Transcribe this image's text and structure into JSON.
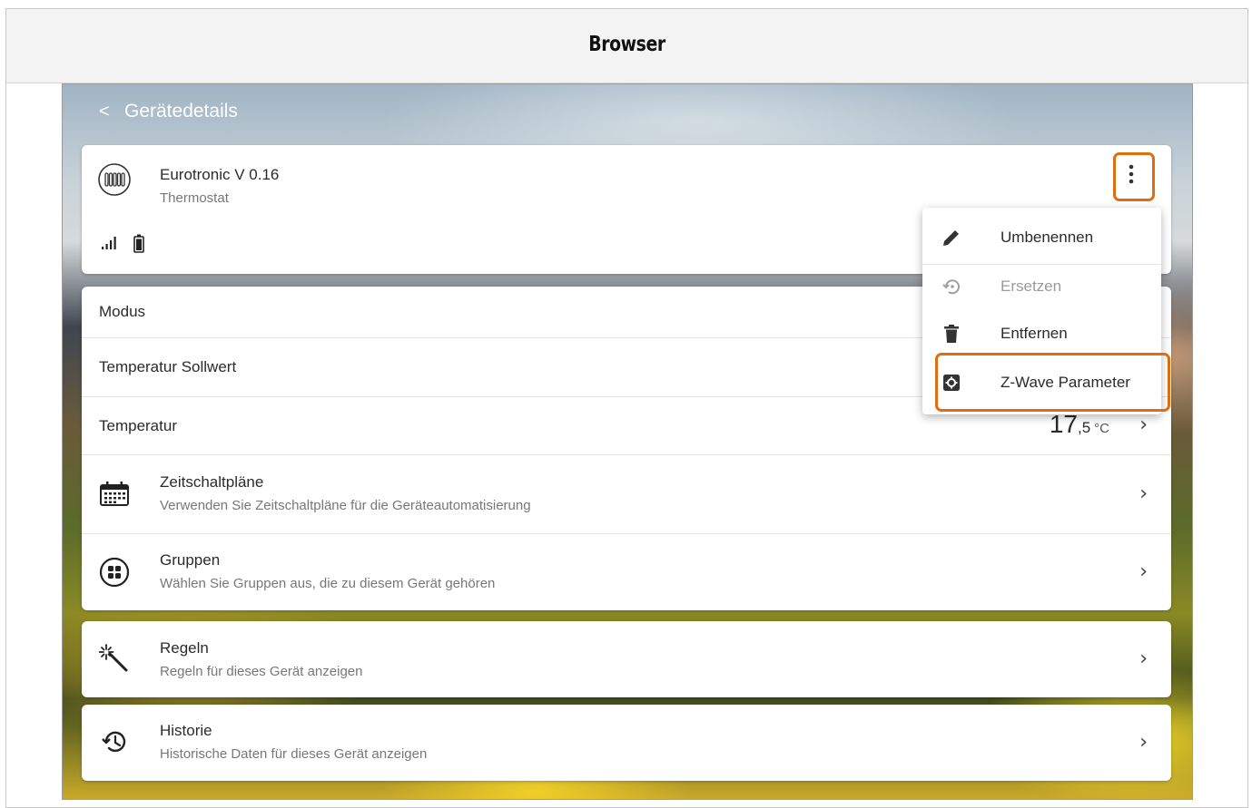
{
  "window": {
    "title": "Browser"
  },
  "header": {
    "back_label": "<",
    "title": "Gerätedetails"
  },
  "device": {
    "name": "Eurotronic V 0.16",
    "type": "Thermostat"
  },
  "rows": {
    "modus": "Modus",
    "sollwert": "Temperatur Sollwert",
    "temperatur": "Temperatur",
    "temp_int": "17",
    "temp_dec": ",5",
    "temp_unit": "°C"
  },
  "sections": [
    {
      "title": "Zeitschaltpläne",
      "subtitle": "Verwenden Sie Zeitschaltpläne für die Geräteautomatisierung"
    },
    {
      "title": "Gruppen",
      "subtitle": "Wählen Sie Gruppen aus, die zu diesem Gerät gehören"
    },
    {
      "title": "Regeln",
      "subtitle": "Regeln für dieses Gerät anzeigen"
    },
    {
      "title": "Historie",
      "subtitle": "Historische Daten für dieses Gerät anzeigen"
    }
  ],
  "menu": [
    {
      "label": "Umbenennen",
      "icon": "pencil-icon",
      "enabled": true
    },
    {
      "label": "Ersetzen",
      "icon": "replace-icon",
      "enabled": false
    },
    {
      "label": "Entfernen",
      "icon": "trash-icon",
      "enabled": true
    },
    {
      "label": "Z-Wave Parameter",
      "icon": "settings-box-icon",
      "enabled": true
    }
  ],
  "colors": {
    "highlight": "#e06d0f"
  }
}
